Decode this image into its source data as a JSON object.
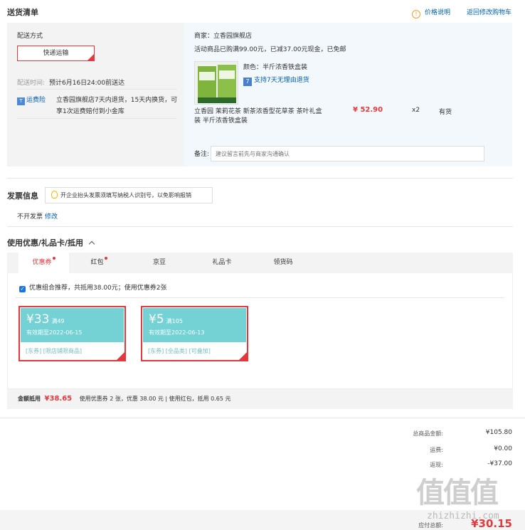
{
  "section_shipping": {
    "title": "送货清单",
    "price_info_icon": "info-icon",
    "price_info_link": "价格说明",
    "back_to_cart_link": "返回修改购物车"
  },
  "shipping": {
    "method_label": "配送方式",
    "method_value": "快递运输",
    "time_label": "配送时间:",
    "time_value": "预计6月16日24:00前送达",
    "freight_icon": "truck-icon",
    "freight_link": "运费险",
    "freight_desc_1": "立香园旗舰店7天内退货，15天内换货，可",
    "freight_desc_2": "享1次运费赔付到小金库"
  },
  "shop": {
    "merchant": "商家：立香园旗舰店",
    "promo": "活动商品已购满99.00元，已减37.00元现金，已免邮",
    "color": "颜色：半斤浓香铁盒装",
    "return_policy": "支持7天无理由退货",
    "product_name_1": "立香园 茉莉花茶 新茶浓香型花草茶 茶叶礼盒",
    "product_name_2": "装 半斤浓香铁盒装",
    "price": "¥ 52.90",
    "qty": "x2",
    "stock": "有货",
    "remark_label": "备注:",
    "remark_placeholder": "建议留言前先与商家沟通确认"
  },
  "invoice": {
    "title": "发票信息",
    "tip": "开企业抬头发票须填写纳税人识别号，以免影响报销",
    "value": "不开发票",
    "edit_link": "修改"
  },
  "coupons": {
    "title": "使用优惠/礼品卡/抵用",
    "tabs": [
      "优惠券",
      "红包",
      "京豆",
      "礼品卡",
      "领货码"
    ],
    "recommend": "优惠组合推荐，共抵用38.00元；使用优惠券2张",
    "items": [
      {
        "amount": "¥33",
        "cond": "满49",
        "expiry": "有效期至2022-06-15",
        "tags": "[东券] [限店铺限商品]"
      },
      {
        "amount": "¥5",
        "cond": "满105",
        "expiry": "有效期至2022-06-13",
        "tags": "[东券] [全品类] [可叠加]"
      }
    ],
    "discount_label": "金额抵用",
    "discount_amount": "¥38.65",
    "discount_detail": "使用优惠券 2 张，优惠 38.00 元 | 使用红包，抵用 0.65 元"
  },
  "totals": {
    "goods_label": "总商品金额:",
    "goods_value": "¥105.80",
    "freight_label": "运费:",
    "freight_value": "¥0.00",
    "rebate_label": "返现:",
    "rebate_value": "-¥37.00",
    "due_label": "应付总额:",
    "due_value": "¥30.15"
  },
  "watermark": {
    "text": "值值值",
    "sub": "zhizhizhi.com"
  },
  "colors": {
    "accent": "#e4393c",
    "link": "#005ea7",
    "coupon": "#74d2d4"
  }
}
